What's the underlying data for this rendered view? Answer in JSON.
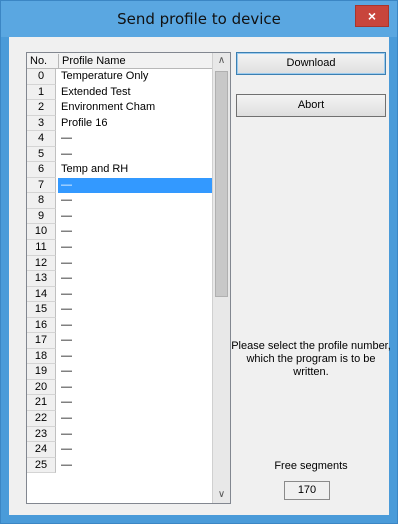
{
  "window": {
    "title": "Send profile to device",
    "close_label": "×"
  },
  "list": {
    "columns": {
      "no": "No.",
      "name": "Profile Name"
    },
    "selected_index": 7,
    "rows": [
      {
        "no": "0",
        "name": "Temperature Only"
      },
      {
        "no": "1",
        "name": "Extended Test"
      },
      {
        "no": "2",
        "name": "Environment Cham"
      },
      {
        "no": "3",
        "name": "Profile 16"
      },
      {
        "no": "4",
        "name": "—"
      },
      {
        "no": "5",
        "name": "—"
      },
      {
        "no": "6",
        "name": "Temp and RH"
      },
      {
        "no": "7",
        "name": "—"
      },
      {
        "no": "8",
        "name": "—"
      },
      {
        "no": "9",
        "name": "—"
      },
      {
        "no": "10",
        "name": "—"
      },
      {
        "no": "11",
        "name": "—"
      },
      {
        "no": "12",
        "name": "—"
      },
      {
        "no": "13",
        "name": "—"
      },
      {
        "no": "14",
        "name": "—"
      },
      {
        "no": "15",
        "name": "—"
      },
      {
        "no": "16",
        "name": "—"
      },
      {
        "no": "17",
        "name": "—"
      },
      {
        "no": "18",
        "name": "—"
      },
      {
        "no": "19",
        "name": "—"
      },
      {
        "no": "20",
        "name": "—"
      },
      {
        "no": "21",
        "name": "—"
      },
      {
        "no": "22",
        "name": "—"
      },
      {
        "no": "23",
        "name": "—"
      },
      {
        "no": "24",
        "name": "—"
      },
      {
        "no": "25",
        "name": "—"
      }
    ],
    "scroll_up_icon": "chevron-up-icon",
    "scroll_down_icon": "chevron-down-icon"
  },
  "buttons": {
    "download": "Download",
    "abort": "Abort"
  },
  "hint": "Please select the profile number, which the program is to be written.",
  "free_segments": {
    "label": "Free segments",
    "value": "170"
  },
  "colors": {
    "title_bar": "#5aa7e1",
    "selection": "#3399ff",
    "close_button": "#c8453c"
  }
}
